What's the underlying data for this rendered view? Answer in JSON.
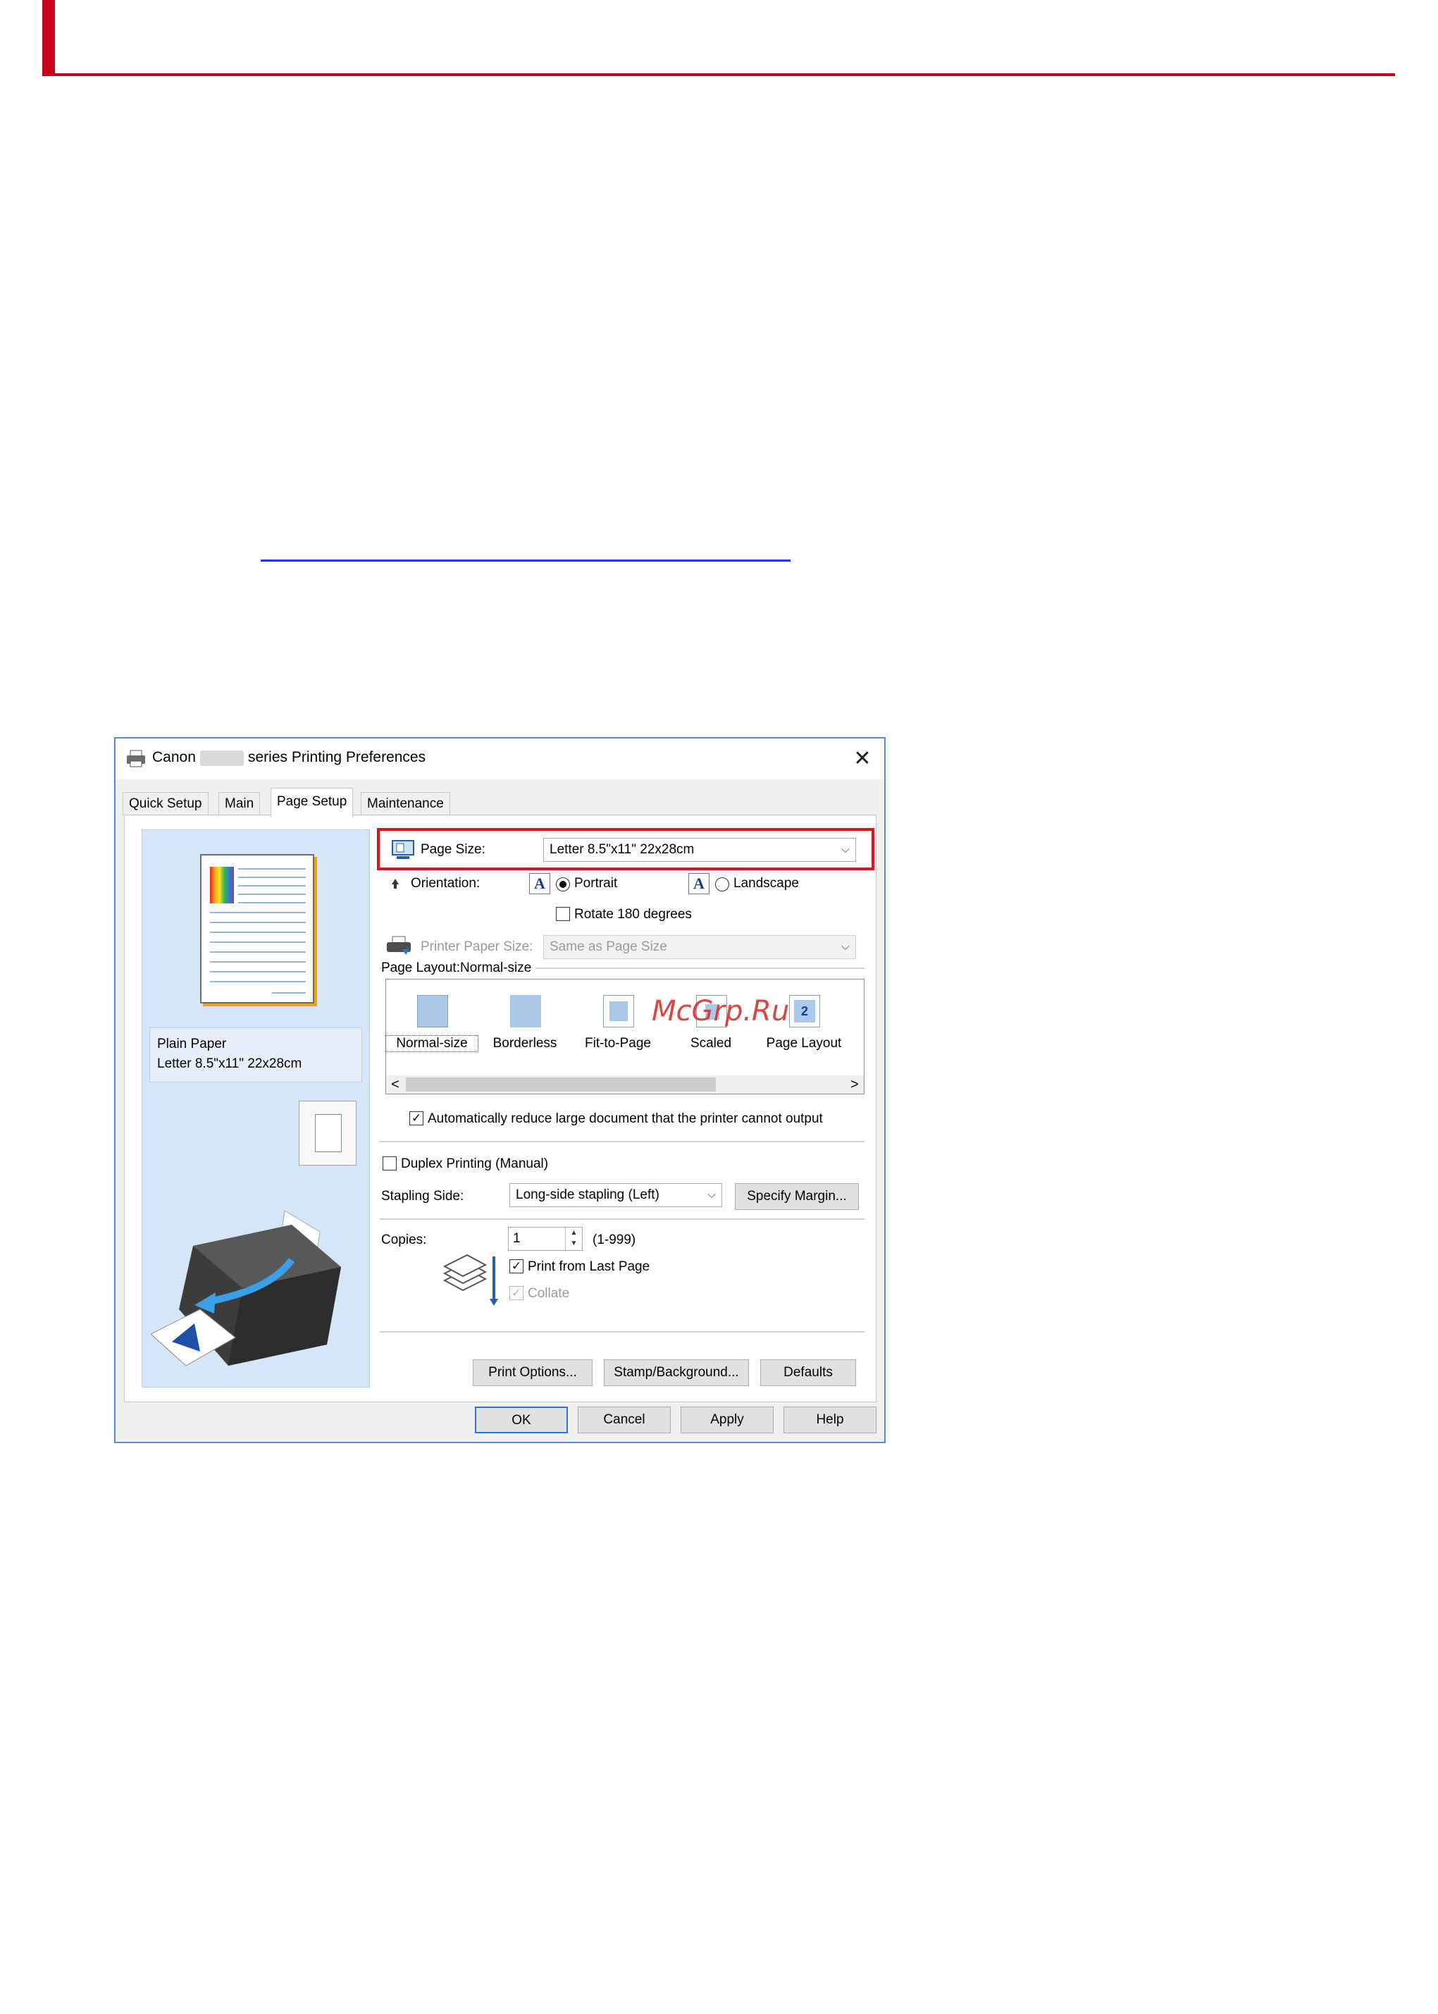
{
  "dialog": {
    "title_prefix": "Canon",
    "title_suffix": "series Printing Preferences",
    "close_glyph": "✕",
    "tabs": [
      {
        "label": "Quick Setup"
      },
      {
        "label": "Main"
      },
      {
        "label": "Page Setup"
      },
      {
        "label": "Maintenance"
      }
    ],
    "active_tab": "Page Setup"
  },
  "preview": {
    "paper_type": "Plain Paper",
    "paper_size": "Letter 8.5\"x11\" 22x28cm"
  },
  "page_setup": {
    "page_size_label": "Page Size:",
    "page_size_value": "Letter 8.5\"x11\" 22x28cm",
    "orientation_label": "Orientation:",
    "portrait_label": "Portrait",
    "landscape_label": "Landscape",
    "orientation_icon_glyph": "A",
    "orientation_selected": "Portrait",
    "rotate_label": "Rotate 180 degrees",
    "rotate_checked": false,
    "printer_paper_size_label": "Printer Paper Size:",
    "printer_paper_size_value": "Same as Page Size",
    "page_layout_heading": "Page Layout:Normal-size",
    "layout_options": [
      {
        "label": "Normal-size",
        "icon": "normal-size-icon"
      },
      {
        "label": "Borderless",
        "icon": "borderless-icon"
      },
      {
        "label": "Fit-to-Page",
        "icon": "fit-to-page-icon"
      },
      {
        "label": "Scaled",
        "icon": "scaled-icon"
      },
      {
        "label": "Page Layout",
        "icon": "page-layout-icon"
      }
    ],
    "page_layout_badge": "2",
    "auto_reduce_label": "Automatically reduce large document that the printer cannot output",
    "auto_reduce_checked": true,
    "duplex_label": "Duplex Printing (Manual)",
    "duplex_checked": false,
    "stapling_side_label": "Stapling Side:",
    "stapling_side_value": "Long-side stapling (Left)",
    "specify_margin_label": "Specify Margin...",
    "copies_label": "Copies:",
    "copies_value": "1",
    "copies_range": "(1-999)",
    "print_from_last_label": "Print from Last Page",
    "print_from_last_checked": true,
    "collate_label": "Collate",
    "collate_checked": true,
    "print_options_label": "Print Options...",
    "stamp_background_label": "Stamp/Background...",
    "defaults_label": "Defaults",
    "scroll_left": "<",
    "scroll_right": ">",
    "check_glyph": "✓",
    "chevron_glyph": "⌵"
  },
  "footer": {
    "ok_label": "OK",
    "cancel_label": "Cancel",
    "apply_label": "Apply",
    "help_label": "Help"
  },
  "watermark": "McGrp.Ru",
  "colors": {
    "accent_red": "#e0141e",
    "header_red": "#c8001e",
    "dialog_border": "#4a8fd8",
    "preview_bg": "#d4e6f7"
  }
}
